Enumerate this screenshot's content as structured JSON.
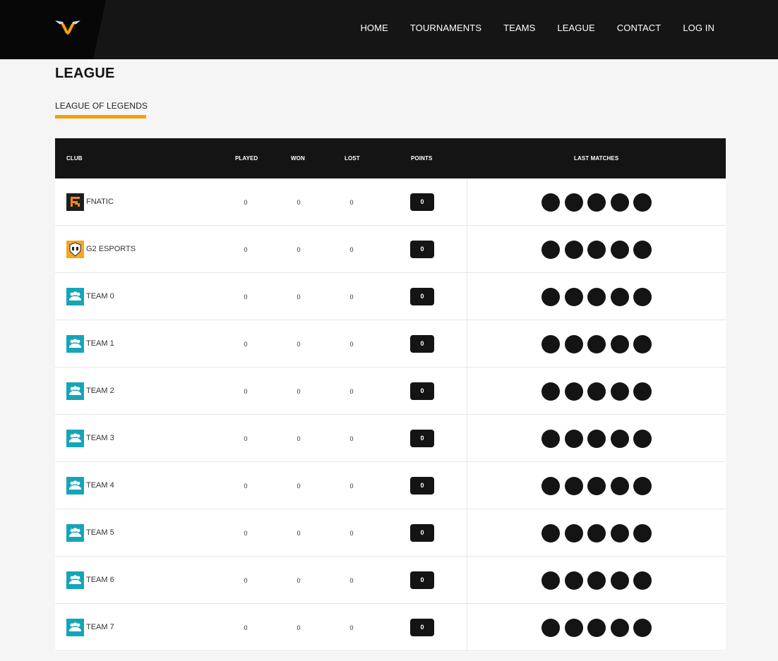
{
  "nav": {
    "items": [
      "HOME",
      "TOURNAMENTS",
      "TEAMS",
      "LEAGUE",
      "CONTACT",
      "LOG IN"
    ]
  },
  "brand": {
    "logo_icon": "v-wings-logo-icon",
    "accent_color": "#f2a007"
  },
  "page": {
    "title": "LEAGUE"
  },
  "tabs": {
    "active": "LEAGUE OF LEGENDS"
  },
  "table": {
    "headers": {
      "club": "CLUB",
      "played": "PLAYED",
      "won": "WON",
      "lost": "LOST",
      "points": "POINTS",
      "last_matches": "LAST MATCHES"
    },
    "rows": [
      {
        "logo": "fnatic-logo-icon",
        "club": "FNATIC",
        "played": "0",
        "won": "0",
        "lost": "0",
        "points": "0",
        "last_matches": 5
      },
      {
        "logo": "g2-logo-icon",
        "club": "G2 ESPORTS",
        "played": "0",
        "won": "0",
        "lost": "0",
        "points": "0",
        "last_matches": 5
      },
      {
        "logo": "team-group-icon",
        "club": "TEAM 0",
        "played": "0",
        "won": "0",
        "lost": "0",
        "points": "0",
        "last_matches": 5
      },
      {
        "logo": "team-group-icon",
        "club": "TEAM 1",
        "played": "0",
        "won": "0",
        "lost": "0",
        "points": "0",
        "last_matches": 5
      },
      {
        "logo": "team-group-icon",
        "club": "TEAM 2",
        "played": "0",
        "won": "0",
        "lost": "0",
        "points": "0",
        "last_matches": 5
      },
      {
        "logo": "team-group-icon",
        "club": "TEAM 3",
        "played": "0",
        "won": "0",
        "lost": "0",
        "points": "0",
        "last_matches": 5
      },
      {
        "logo": "team-group-icon",
        "club": "TEAM 4",
        "played": "0",
        "won": "0",
        "lost": "0",
        "points": "0",
        "last_matches": 5
      },
      {
        "logo": "team-group-icon",
        "club": "TEAM 5",
        "played": "0",
        "won": "0",
        "lost": "0",
        "points": "0",
        "last_matches": 5
      },
      {
        "logo": "team-group-icon",
        "club": "TEAM 6",
        "played": "0",
        "won": "0",
        "lost": "0",
        "points": "0",
        "last_matches": 5
      },
      {
        "logo": "team-group-icon",
        "club": "TEAM 7",
        "played": "0",
        "won": "0",
        "lost": "0",
        "points": "0",
        "last_matches": 5
      }
    ]
  }
}
